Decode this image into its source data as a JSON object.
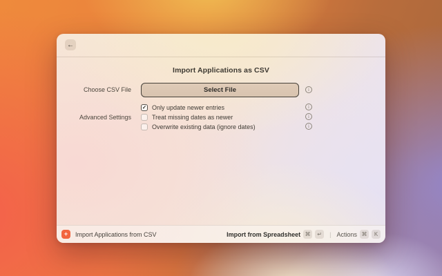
{
  "window": {
    "header": {
      "back_icon": "←"
    },
    "title": "Import Applications as CSV"
  },
  "form": {
    "file_field": {
      "label": "Choose CSV File",
      "button": "Select File"
    },
    "advanced": {
      "label": "Advanced Settings",
      "options": [
        {
          "label": "Only update newer entries",
          "checked": true
        },
        {
          "label": "Treat missing dates as newer",
          "checked": false
        },
        {
          "label": "Overwrite existing data (ignore dates)",
          "checked": false
        }
      ]
    },
    "check_glyph": "✓",
    "info_glyph": "i"
  },
  "footer": {
    "command": {
      "icon": "+",
      "label": "Import Applications from CSV"
    },
    "primary": {
      "label": "Import from Spreadsheet",
      "keys": [
        "⌘",
        "↵"
      ]
    },
    "secondary": {
      "label": "Actions",
      "keys": [
        "⌘",
        "K"
      ]
    },
    "divider": "|"
  },
  "colors": {
    "accent_orange": "#f2653f",
    "window_cream": "#f6e8d8",
    "background_purple": "#9488d1",
    "background_orange": "#ef8a3c"
  }
}
